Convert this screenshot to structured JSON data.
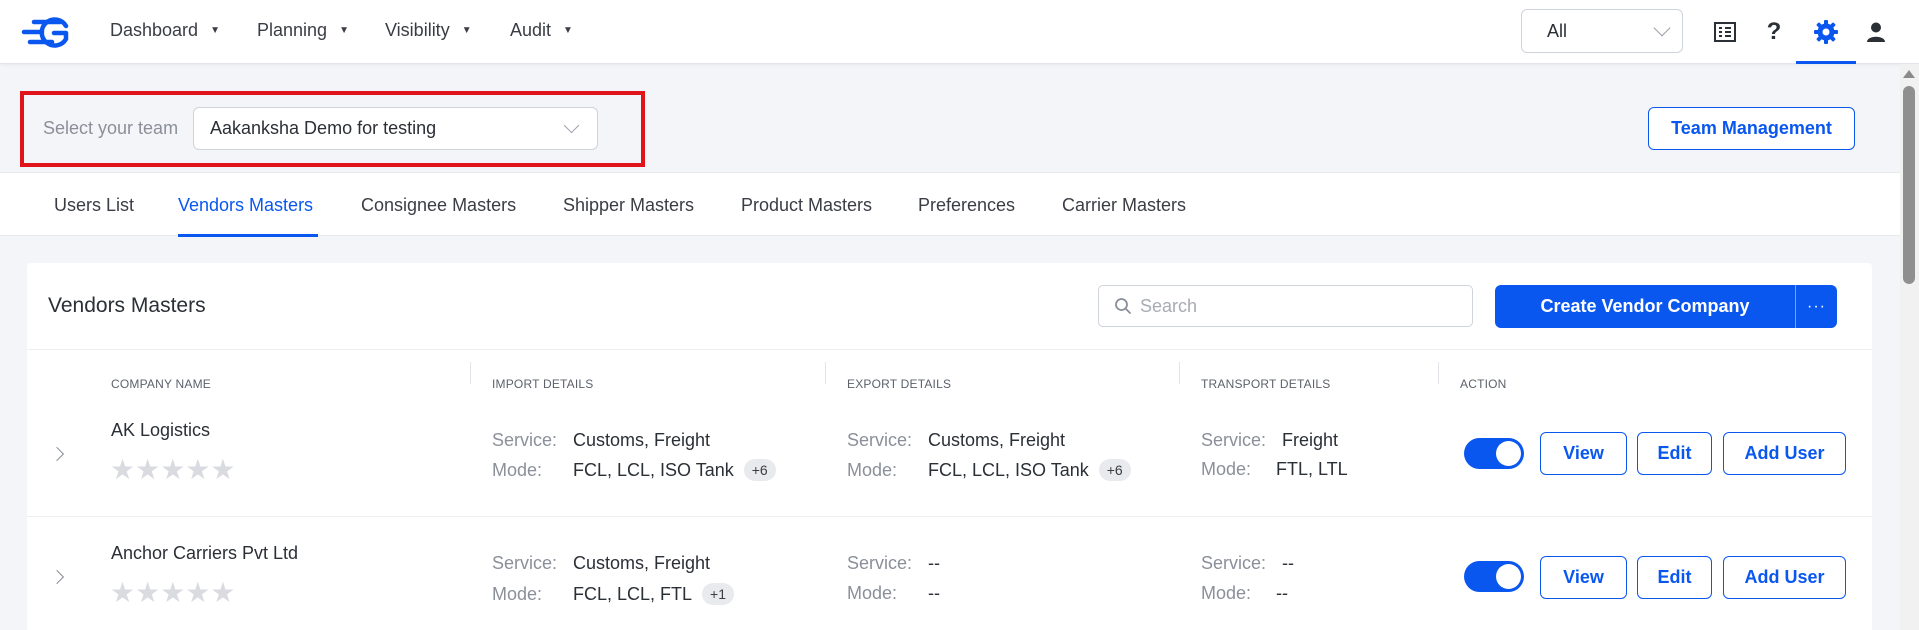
{
  "nav": {
    "items": [
      {
        "label": "Dashboard"
      },
      {
        "label": "Planning"
      },
      {
        "label": "Visibility"
      },
      {
        "label": "Audit"
      }
    ],
    "scope_select": "All",
    "icons": [
      "document-list-icon",
      "help-icon",
      "gear-icon",
      "user-icon"
    ],
    "accent_color": "#0a57f0"
  },
  "team": {
    "label": "Select your team",
    "selected": "Aakanksha Demo for testing",
    "management_button": "Team Management",
    "highlight_color": "#e0141b"
  },
  "tabs": [
    {
      "label": "Users List",
      "active": false
    },
    {
      "label": "Vendors Masters",
      "active": true
    },
    {
      "label": "Consignee Masters",
      "active": false
    },
    {
      "label": "Shipper Masters",
      "active": false
    },
    {
      "label": "Product Masters",
      "active": false
    },
    {
      "label": "Preferences",
      "active": false
    },
    {
      "label": "Carrier Masters",
      "active": false
    }
  ],
  "main": {
    "title": "Vendors Masters",
    "search_placeholder": "Search",
    "create_button": "Create Vendor Company",
    "more_button": "···",
    "columns": [
      "COMPANY NAME",
      "IMPORT DETAILS",
      "EXPORT DETAILS",
      "TRANSPORT DETAILS",
      "ACTION"
    ],
    "field_labels": {
      "service": "Service:",
      "mode": "Mode:"
    },
    "rows": [
      {
        "company": "AK Logistics",
        "rating": 0,
        "stars": "★★★★★",
        "import": {
          "service": "Customs, Freight",
          "mode": "FCL, LCL, ISO Tank",
          "more": "+6"
        },
        "export": {
          "service": "Customs, Freight",
          "mode": "FCL, LCL, ISO Tank",
          "more": "+6"
        },
        "transport": {
          "service": "Freight",
          "mode": "FTL, LTL"
        },
        "active": true,
        "actions": {
          "view": "View",
          "edit": "Edit",
          "add_user": "Add User"
        }
      },
      {
        "company": "Anchor Carriers Pvt Ltd",
        "rating": 0,
        "stars": "★★★★★",
        "import": {
          "service": "Customs, Freight",
          "mode": "FCL, LCL, FTL",
          "more": "+1"
        },
        "export": {
          "service": "--",
          "mode": "--"
        },
        "transport": {
          "service": "--",
          "mode": "--"
        },
        "active": true,
        "actions": {
          "view": "View",
          "edit": "Edit",
          "add_user": "Add User"
        }
      }
    ]
  }
}
